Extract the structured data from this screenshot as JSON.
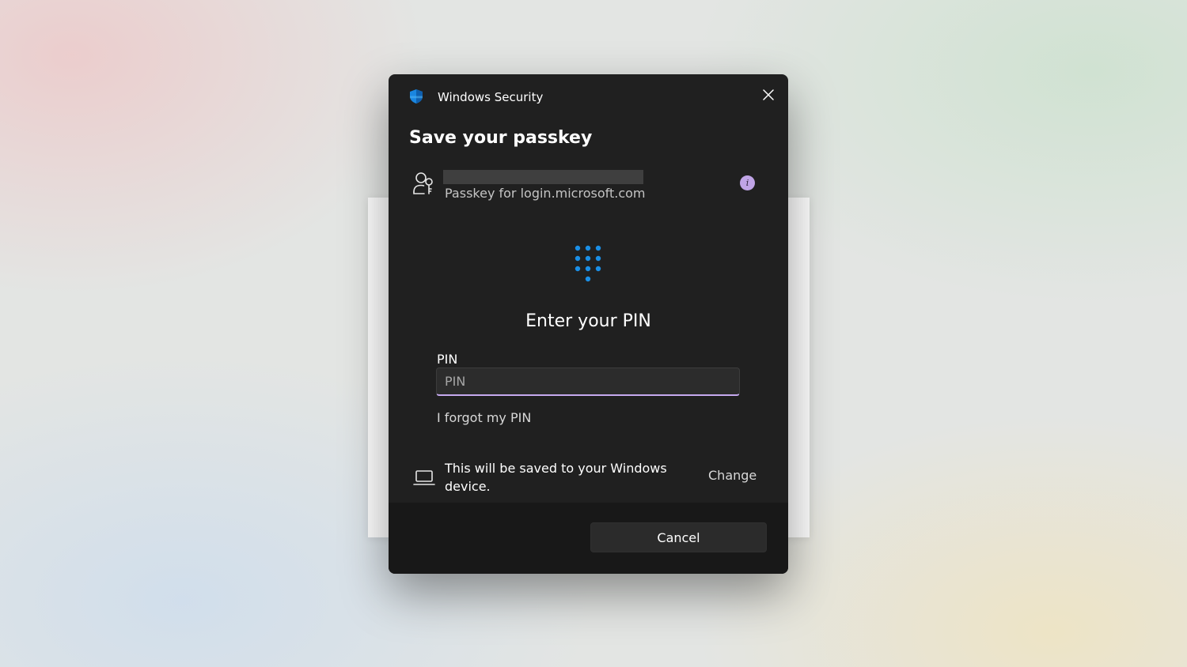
{
  "dialog": {
    "app_title": "Windows Security",
    "heading": "Save your passkey",
    "account": {
      "subtitle": "Passkey for login.microsoft.com"
    },
    "pin": {
      "heading": "Enter your PIN",
      "label": "PIN",
      "placeholder": "PIN",
      "value": "",
      "forgot_link": "I forgot my PIN"
    },
    "save_location": {
      "text": "This will be saved to your Windows device.",
      "change_link": "Change"
    },
    "cancel_label": "Cancel"
  },
  "icons": {
    "app": "shield-icon",
    "close": "close-icon",
    "account": "person-key-icon",
    "info": "info-icon",
    "pin": "keypad-icon",
    "device": "laptop-icon"
  },
  "colors": {
    "dialog_bg": "#202020",
    "footer_bg": "#181818",
    "accent": "#c6aaf0",
    "info_badge": "#c0a4e6",
    "keypad_dots": "#1a8fe6",
    "shield": "#1a86e0"
  }
}
